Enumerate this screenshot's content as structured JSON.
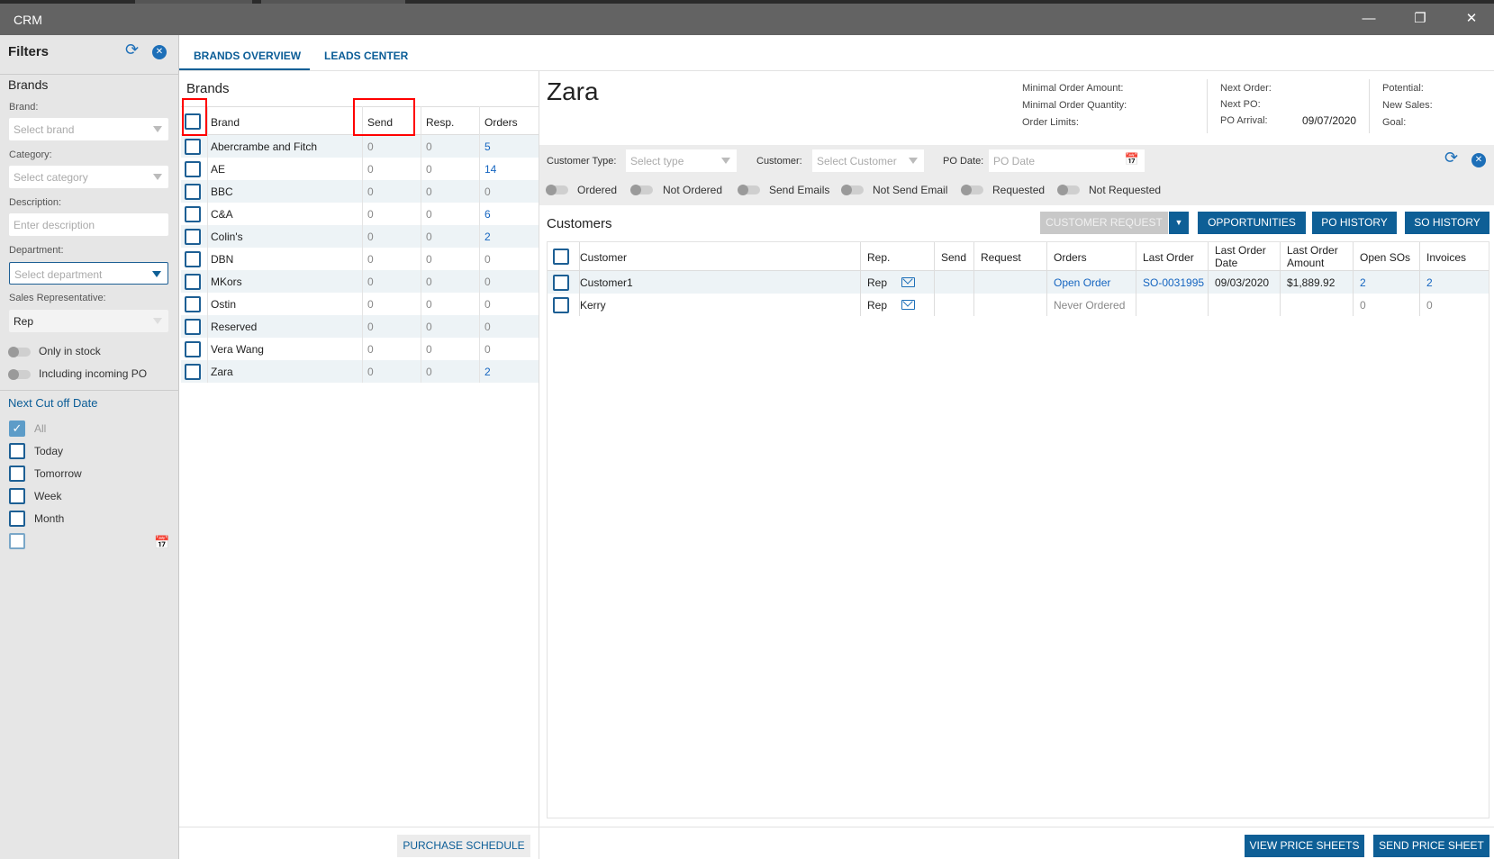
{
  "window": {
    "title": "CRM",
    "minimize": "—",
    "restore": "❐",
    "close": "✕"
  },
  "filters": {
    "title": "Filters",
    "section": "Brands",
    "brand_label": "Brand:",
    "brand_placeholder": "Select brand",
    "category_label": "Category:",
    "category_placeholder": "Select category",
    "description_label": "Description:",
    "description_placeholder": "Enter description",
    "department_label": "Department:",
    "department_placeholder": "Select department",
    "salesrep_label": "Sales Representative:",
    "salesrep_value": "Rep",
    "only_in_stock": "Only in stock",
    "including_po": "Including incoming PO",
    "cutoff_title": "Next Cut off Date",
    "cutoff_options": [
      {
        "label": "All",
        "checked": true
      },
      {
        "label": "Today"
      },
      {
        "label": "Tomorrow"
      },
      {
        "label": "Week"
      },
      {
        "label": "Month"
      }
    ]
  },
  "tabs": [
    {
      "label": "BRANDS OVERVIEW",
      "active": true
    },
    {
      "label": "LEADS CENTER"
    }
  ],
  "brands": {
    "title": "Brands",
    "columns": [
      "Brand",
      "Send",
      "Resp.",
      "Orders"
    ],
    "rows": [
      {
        "brand": "Abercrambe and Fitch",
        "send": "0",
        "resp": "0",
        "orders": "5",
        "link": true
      },
      {
        "brand": "AE",
        "send": "0",
        "resp": "0",
        "orders": "14",
        "link": true
      },
      {
        "brand": "BBC",
        "send": "0",
        "resp": "0",
        "orders": "0"
      },
      {
        "brand": "C&A",
        "send": "0",
        "resp": "0",
        "orders": "6",
        "link": true
      },
      {
        "brand": "Colin's",
        "send": "0",
        "resp": "0",
        "orders": "2",
        "link": true
      },
      {
        "brand": "DBN",
        "send": "0",
        "resp": "0",
        "orders": "0"
      },
      {
        "brand": "MKors",
        "send": "0",
        "resp": "0",
        "orders": "0"
      },
      {
        "brand": "Ostin",
        "send": "0",
        "resp": "0",
        "orders": "0"
      },
      {
        "brand": "Reserved",
        "send": "0",
        "resp": "0",
        "orders": "0"
      },
      {
        "brand": "Vera Wang",
        "send": "0",
        "resp": "0",
        "orders": "0"
      },
      {
        "brand": "Zara",
        "send": "0",
        "resp": "0",
        "orders": "2",
        "link": true
      }
    ],
    "purchase_schedule": "PURCHASE SCHEDULE"
  },
  "detail": {
    "brand_name": "Zara",
    "info": {
      "min_order_amount": "Minimal Order Amount:",
      "min_order_qty": "Minimal Order Quantity:",
      "order_limits": "Order Limits:",
      "next_order": "Next Order:",
      "next_po": "Next PO:",
      "po_arrival": "PO Arrival:",
      "po_arrival_value": "09/07/2020",
      "potential": "Potential:",
      "new_sales": "New Sales:",
      "goal": "Goal:"
    },
    "filter": {
      "customer_type_label": "Customer Type:",
      "customer_type_placeholder": "Select type",
      "customer_label": "Customer:",
      "customer_placeholder": "Select Customer",
      "po_date_label": "PO Date:",
      "po_date_placeholder": "PO Date",
      "toggles": [
        "Ordered",
        "Not Ordered",
        "Send Emails",
        "Not Send Email",
        "Requested",
        "Not Requested"
      ]
    },
    "customers_title": "Customers",
    "buttons": {
      "customer_request": "CUSTOMER REQUEST",
      "opportunities": "OPPORTUNITIES",
      "po_history": "PO HISTORY",
      "so_history": "SO HISTORY"
    },
    "columns": [
      "Customer",
      "Rep.",
      "Send",
      "Request",
      "Orders",
      "Last Order",
      "Last Order Date",
      "Last Order Amount",
      "Open SOs",
      "Invoices"
    ],
    "rows": [
      {
        "customer": "Customer1",
        "rep": "Rep",
        "request": "",
        "orders": "Open Order",
        "last_order": "SO-0031995",
        "date": "09/03/2020",
        "amount": "$1,889.92",
        "open_sos": "2",
        "invoices": "2"
      },
      {
        "customer": "Kerry",
        "rep": "Rep",
        "request": "",
        "orders": "Never Ordered",
        "last_order": "",
        "date": "",
        "amount": "",
        "open_sos": "0",
        "invoices": "0"
      }
    ],
    "view_price_sheets": "VIEW PRICE SHEETS",
    "send_price_sheet": "SEND PRICE SHEET"
  },
  "colors": {
    "accent": "#0e5f96",
    "link": "#1565c0",
    "highlight": "#ff0000"
  }
}
